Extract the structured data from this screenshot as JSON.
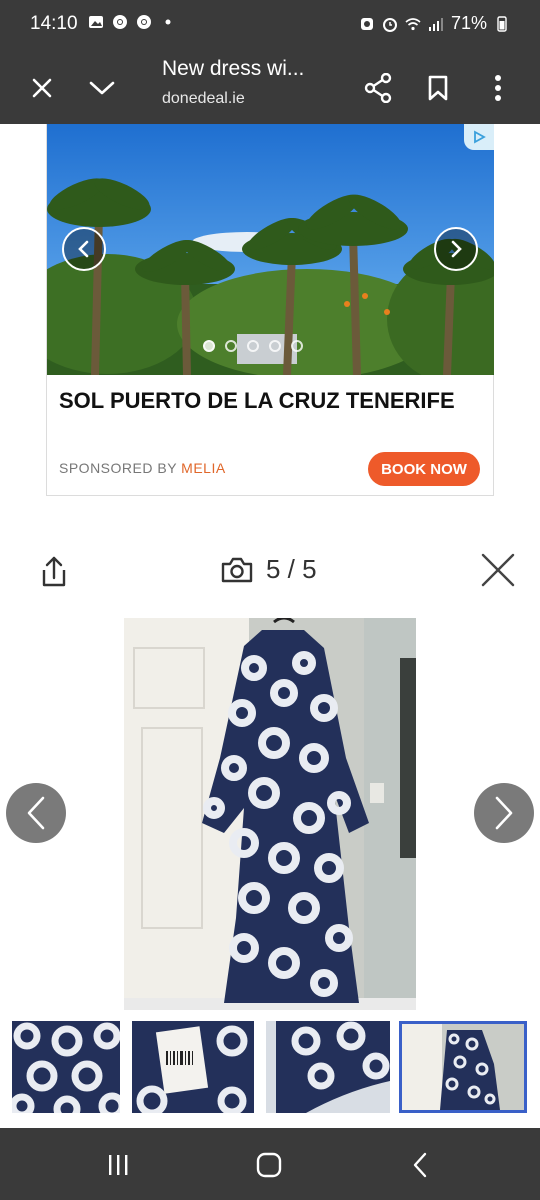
{
  "status_bar": {
    "time": "14:10",
    "battery": "71%",
    "left_icons": [
      "gallery-icon",
      "chrome-icon",
      "chrome-icon",
      "dot-icon"
    ],
    "right_icons": [
      "alarm-icon",
      "clock-icon",
      "wifi-icon",
      "signal-icon",
      "battery-icon"
    ]
  },
  "toolbar": {
    "title": "New dress wi...",
    "url": "donedeal.ie"
  },
  "ad": {
    "title": "SOL PUERTO DE LA CRUZ TENERIFE",
    "sponsored_label": "SPONSORED BY",
    "sponsor": "MELIA",
    "cta": "BOOK NOW",
    "accent_color": "#ee5a2a"
  },
  "viewer": {
    "counter": "5 / 5",
    "current": 5,
    "total": 5
  },
  "colors": {
    "chrome_bar": "#3a3a3a",
    "thumb_selected_border": "#3a60c8",
    "dress_navy": "#23305a"
  }
}
